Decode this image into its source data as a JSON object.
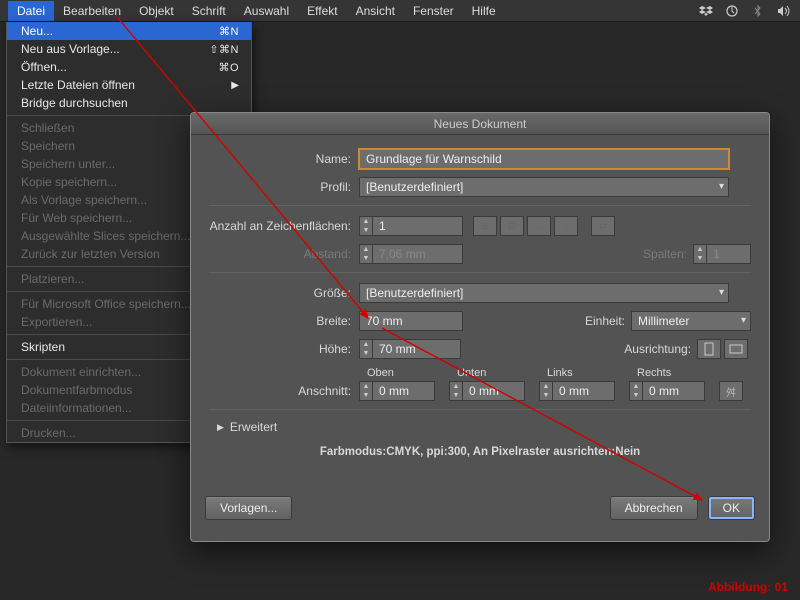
{
  "menubar": {
    "items": [
      "Datei",
      "Bearbeiten",
      "Objekt",
      "Schrift",
      "Auswahl",
      "Effekt",
      "Ansicht",
      "Fenster",
      "Hilfe"
    ]
  },
  "dropdown": {
    "neu": {
      "label": "Neu...",
      "shortcut": "⌘N"
    },
    "neu_vorlage": {
      "label": "Neu aus Vorlage...",
      "shortcut": "⇧⌘N"
    },
    "oeffnen": {
      "label": "Öffnen...",
      "shortcut": "⌘O"
    },
    "letzte": {
      "label": "Letzte Dateien öffnen",
      "sub": "▶"
    },
    "bridge": {
      "label": "Bridge durchsuchen"
    },
    "schliessen": {
      "label": "Schließen"
    },
    "speichern": {
      "label": "Speichern"
    },
    "speichern_unter": {
      "label": "Speichern unter..."
    },
    "kopie": {
      "label": "Kopie speichern..."
    },
    "als_vorlage": {
      "label": "Als Vorlage speichern..."
    },
    "fuer_web": {
      "label": "Für Web speichern..."
    },
    "slices": {
      "label": "Ausgewählte Slices speichern..."
    },
    "zurueck": {
      "label": "Zurück zur letzten Version"
    },
    "platzieren": {
      "label": "Platzieren..."
    },
    "office": {
      "label": "Für Microsoft Office speichern..."
    },
    "exportieren": {
      "label": "Exportieren..."
    },
    "skripten": {
      "label": "Skripten"
    },
    "einrichten": {
      "label": "Dokument einrichten..."
    },
    "farbmodus": {
      "label": "Dokumentfarbmodus"
    },
    "dateiinfo": {
      "label": "Dateiinformationen..."
    },
    "drucken": {
      "label": "Drucken..."
    }
  },
  "dialog": {
    "title": "Neues Dokument",
    "name_label": "Name:",
    "name_value": "Grundlage für Warnschild",
    "profil_label": "Profil:",
    "profil_value": "[Benutzerdefiniert]",
    "artboards_label": "Anzahl an Zeichenflächen:",
    "artboards_value": "1",
    "abstand_label": "Abstand:",
    "abstand_value": "7,06 mm",
    "spalten_label": "Spalten:",
    "spalten_value": "1",
    "groesse_label": "Größe:",
    "groesse_value": "[Benutzerdefiniert]",
    "breite_label": "Breite:",
    "breite_value": "70 mm",
    "einheit_label": "Einheit:",
    "einheit_value": "Millimeter",
    "hoehe_label": "Höhe:",
    "hoehe_value": "70 mm",
    "ausrichtung_label": "Ausrichtung:",
    "bleed_label": "Anschnitt:",
    "bleed_cols": {
      "oben": "Oben",
      "unten": "Unten",
      "links": "Links",
      "rechts": "Rechts"
    },
    "bleed_value": "0 mm",
    "erweitert": "Erweitert",
    "summary": "Farbmodus:CMYK, ppi:300, An Pixelraster ausrichten:Nein",
    "vorlagen_btn": "Vorlagen...",
    "abbrechen_btn": "Abbrechen",
    "ok_btn": "OK"
  },
  "caption": "Abbildung: 01"
}
